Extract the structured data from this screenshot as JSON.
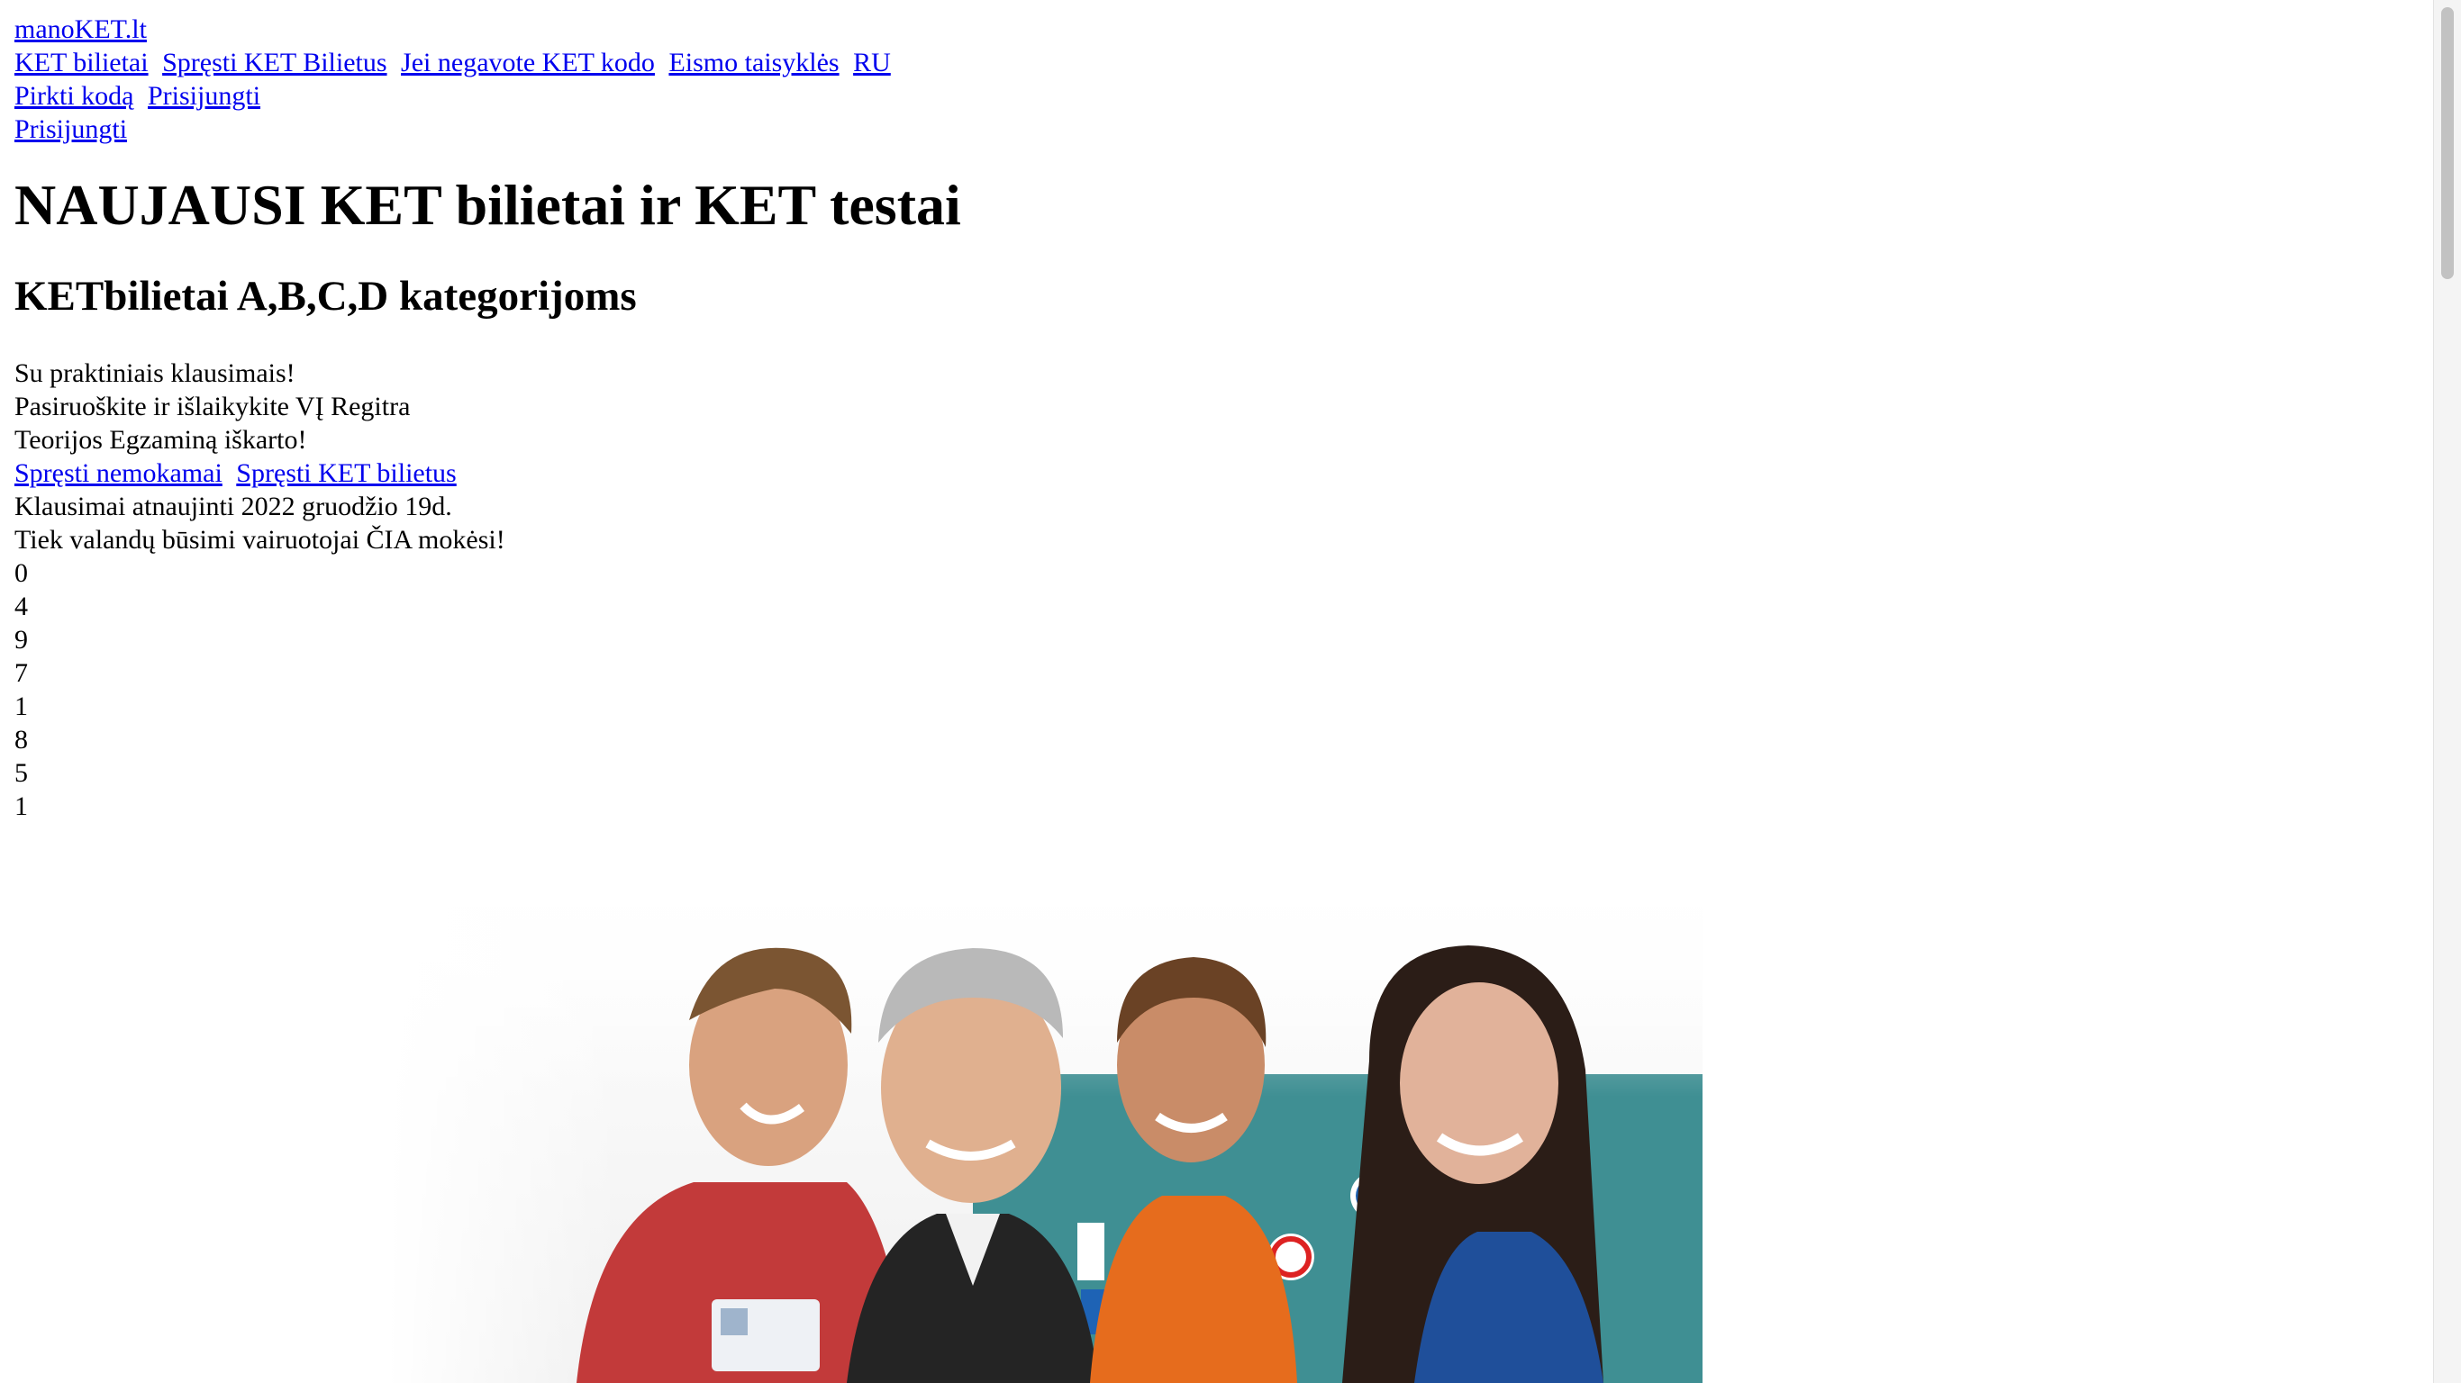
{
  "site": {
    "logo_link": "manoKET.lt"
  },
  "nav": {
    "items": [
      {
        "label": "KET bilietai"
      },
      {
        "label": "Spręsti KET Bilietus"
      },
      {
        "label": "Jei negavote KET kodo"
      },
      {
        "label": "Eismo taisyklės"
      },
      {
        "label": "RU"
      }
    ]
  },
  "account": {
    "buy_code": "Pirkti kodą",
    "login": "Prisijungti",
    "login_alt": "Prisijungti"
  },
  "hero": {
    "title": "NAUJAUSI KET bilietai ir KET testai",
    "subtitle": "KETbilietai A,B,C,D kategorijoms",
    "lines": [
      "Su praktiniais klausimais!",
      "Pasiruoškite ir išlaikykite VĮ Regitra",
      "Teorijos Egzaminą iškarto!"
    ],
    "cta_free": "Spręsti nemokamai",
    "cta_tickets": "Spręsti KET bilietus",
    "updated": "Klausimai atnaujinti 2022 gruodžio 19d.",
    "counter_caption": "Tiek valandų būsimi vairuotojai ČIA mokėsi!",
    "counter_digits": [
      "0",
      "4",
      "9",
      "7",
      "1",
      "8",
      "5",
      "1"
    ]
  },
  "image": {
    "description_icon": "people-with-driving-licenses-photo"
  }
}
